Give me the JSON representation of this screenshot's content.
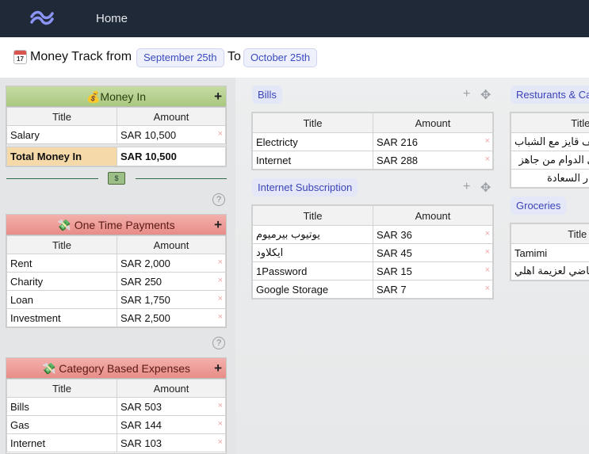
{
  "nav": {
    "home_label": "Home"
  },
  "header": {
    "calendar_num": "17",
    "title_prefix": "Money Track from",
    "from_date": "September 25th",
    "to_label": "To",
    "to_date": "October 25th"
  },
  "money_in": {
    "title": "💰Money In",
    "col_title": "Title",
    "col_amount": "Amount",
    "rows": [
      {
        "title": "Salary",
        "amount": "SAR 10,500"
      }
    ],
    "total_label": "Total Money In",
    "total_value": "SAR 10,500"
  },
  "one_time": {
    "title": "💸 One Time Payments",
    "col_title": "Title",
    "col_amount": "Amount",
    "rows": [
      {
        "title": "Rent",
        "amount": "SAR 2,000"
      },
      {
        "title": "Charity",
        "amount": "SAR 250"
      },
      {
        "title": "Loan",
        "amount": "SAR 1,750"
      },
      {
        "title": "Investment",
        "amount": "SAR 2,500"
      }
    ]
  },
  "category": {
    "title": "💸 Category Based Expenses",
    "col_title": "Title",
    "col_amount": "Amount",
    "rows": [
      {
        "title": "Bills",
        "amount": "SAR 503"
      },
      {
        "title": "Gas",
        "amount": "SAR 144"
      },
      {
        "title": "Internet",
        "amount": "SAR 103"
      }
    ]
  },
  "bills": {
    "tag": "Bills",
    "col_title": "Title",
    "col_amount": "Amount",
    "rows": [
      {
        "title": "Electricty",
        "amount": "SAR 216"
      },
      {
        "title": "Internet",
        "amount": "SAR 288"
      }
    ]
  },
  "internet_sub": {
    "tag": "Internet Subscription",
    "col_title": "Title",
    "col_amount": "Amount",
    "rows": [
      {
        "title": "يوتيوب بيرميوم",
        "amount": "SAR 36"
      },
      {
        "title": "ايكلاود",
        "amount": "SAR 45"
      },
      {
        "title": "1Password",
        "amount": "SAR 15"
      },
      {
        "title": "Google Storage",
        "amount": "SAR 7"
      }
    ]
  },
  "restaurants": {
    "tag": "Resturants & Ca",
    "col_title": "Title",
    "rows": [
      {
        "title": "كيف قايز مع الشباب"
      },
      {
        "title": "في الدوام من جاهز"
      },
      {
        "title": "دوار السعادة"
      }
    ]
  },
  "groceries": {
    "tag": "Groceries",
    "col_title": "Title",
    "rows": [
      {
        "title": "Tamimi"
      },
      {
        "title": "قاضي لعزيمة اهلي"
      }
    ]
  },
  "icons": {
    "plus": "+",
    "move": "✥",
    "remove": "×",
    "help": "?"
  }
}
